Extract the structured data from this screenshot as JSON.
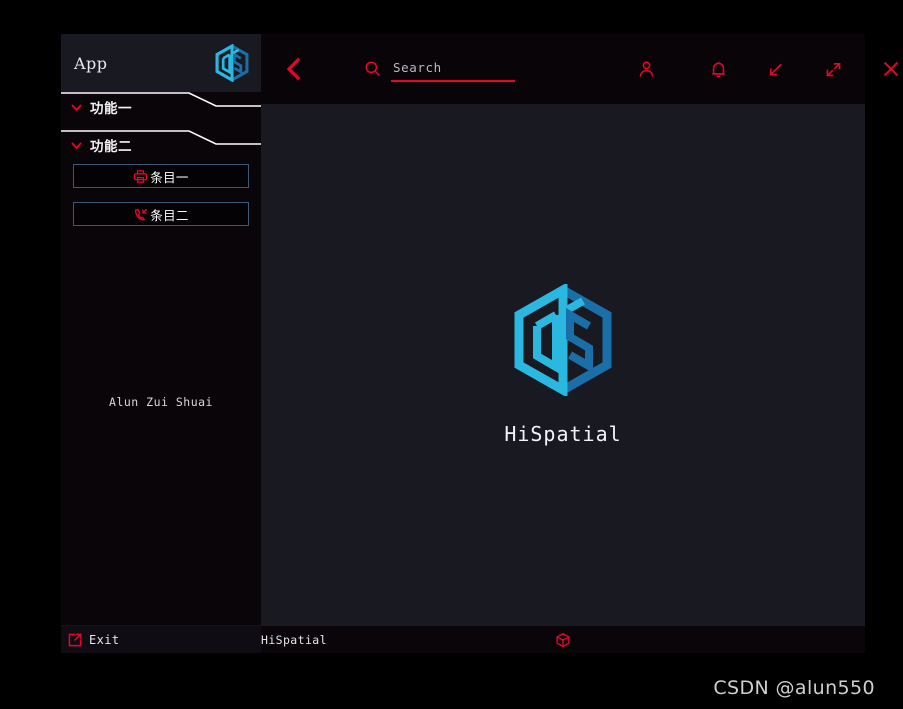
{
  "window": {
    "sidebar": {
      "app_title": "App",
      "logo_icon": "hispatial-cube-logo-icon",
      "menu_groups": [
        {
          "label": "功能一",
          "chevron_icon": "chevron-down-icon"
        },
        {
          "label": "功能二",
          "chevron_icon": "chevron-down-icon"
        }
      ],
      "items": [
        {
          "label": "条目一",
          "icon": "printer-icon"
        },
        {
          "label": "条目二",
          "icon": "phone-incoming-icon"
        }
      ],
      "user_name": "Alun Zui Shuai",
      "footer": {
        "label": "Exit",
        "icon": "exit-external-link-icon"
      }
    },
    "toolbar": {
      "back_icon": "chevron-left-icon",
      "search": {
        "icon": "search-icon",
        "value": "",
        "placeholder": "Search"
      },
      "actions": [
        {
          "name": "user-account-button",
          "icon": "user-icon"
        },
        {
          "name": "notifications-button",
          "icon": "bell-icon"
        },
        {
          "name": "minimize-button",
          "icon": "arrow-down-left-icon"
        },
        {
          "name": "maximize-button",
          "icon": "arrows-diagonal-expand-icon"
        },
        {
          "name": "close-button",
          "icon": "close-x-icon"
        }
      ]
    },
    "content": {
      "logo_icon": "hispatial-cube-logo-icon",
      "brand": "HiSpatial"
    },
    "statusbar": {
      "label": "HiSpatial",
      "cube_icon": "cube-outline-icon"
    }
  },
  "watermark": "CSDN @alun550",
  "colors": {
    "accent_red": "#e8052a",
    "logo_light": "#2bb8e0",
    "logo_dark": "#1a6fa8",
    "item_border": "#3b5878",
    "panel_bg": "#191922",
    "app_bg": "#0a0508"
  }
}
